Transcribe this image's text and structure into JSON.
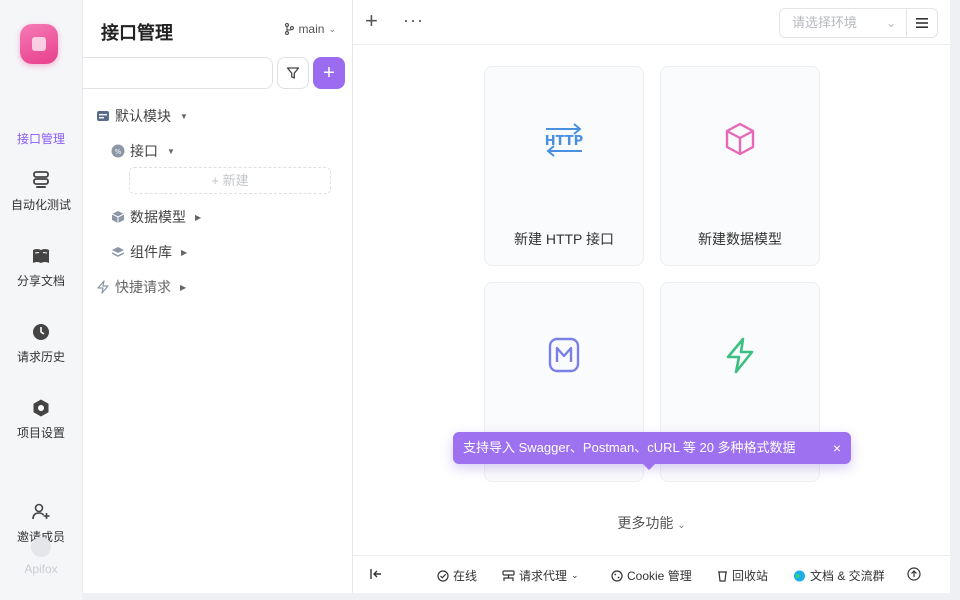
{
  "rail": {
    "items": [
      {
        "label": "接口管理",
        "icon": "api-icon",
        "active": true
      },
      {
        "label": "自动化测试",
        "icon": "test-icon",
        "active": false
      },
      {
        "label": "分享文档",
        "icon": "book-icon",
        "active": false
      },
      {
        "label": "请求历史",
        "icon": "clock-icon",
        "active": false
      },
      {
        "label": "项目设置",
        "icon": "settings-icon",
        "active": false
      },
      {
        "label": "邀请成员",
        "icon": "add-user-icon",
        "active": false
      }
    ],
    "brand": "Apifox"
  },
  "panel": {
    "title": "接口管理",
    "branch": "main",
    "search_value": "",
    "tree": [
      {
        "label": "默认模块"
      },
      {
        "label": "接口"
      },
      {
        "label": "新建"
      },
      {
        "label": "数据模型"
      },
      {
        "label": "组件库"
      },
      {
        "label": "快捷请求"
      }
    ]
  },
  "topbar": {
    "env_placeholder": "请选择环境"
  },
  "cards": [
    {
      "label": "新建 HTTP 接口",
      "icon": "http-icon"
    },
    {
      "label": "新建数据模型",
      "icon": "cube-icon"
    },
    {
      "label": "",
      "icon": "markdown-icon"
    },
    {
      "label": "",
      "icon": "lightning-icon"
    }
  ],
  "tooltip": {
    "text": "支持导入 Swagger、Postman、cURL 等 20 多种格式数据",
    "close": "×"
  },
  "more_functions": "更多功能",
  "statusbar": {
    "online": "在线",
    "proxy": "请求代理",
    "cookie": "Cookie 管理",
    "recycle": "回收站",
    "docs": "文档 & 交流群"
  },
  "colors": {
    "accent": "#9b6cf0",
    "http_blue": "#4a90e2",
    "cube_pink": "#e868b8",
    "md_purple": "#7b7fe8",
    "bolt_green": "#3cbf82"
  }
}
